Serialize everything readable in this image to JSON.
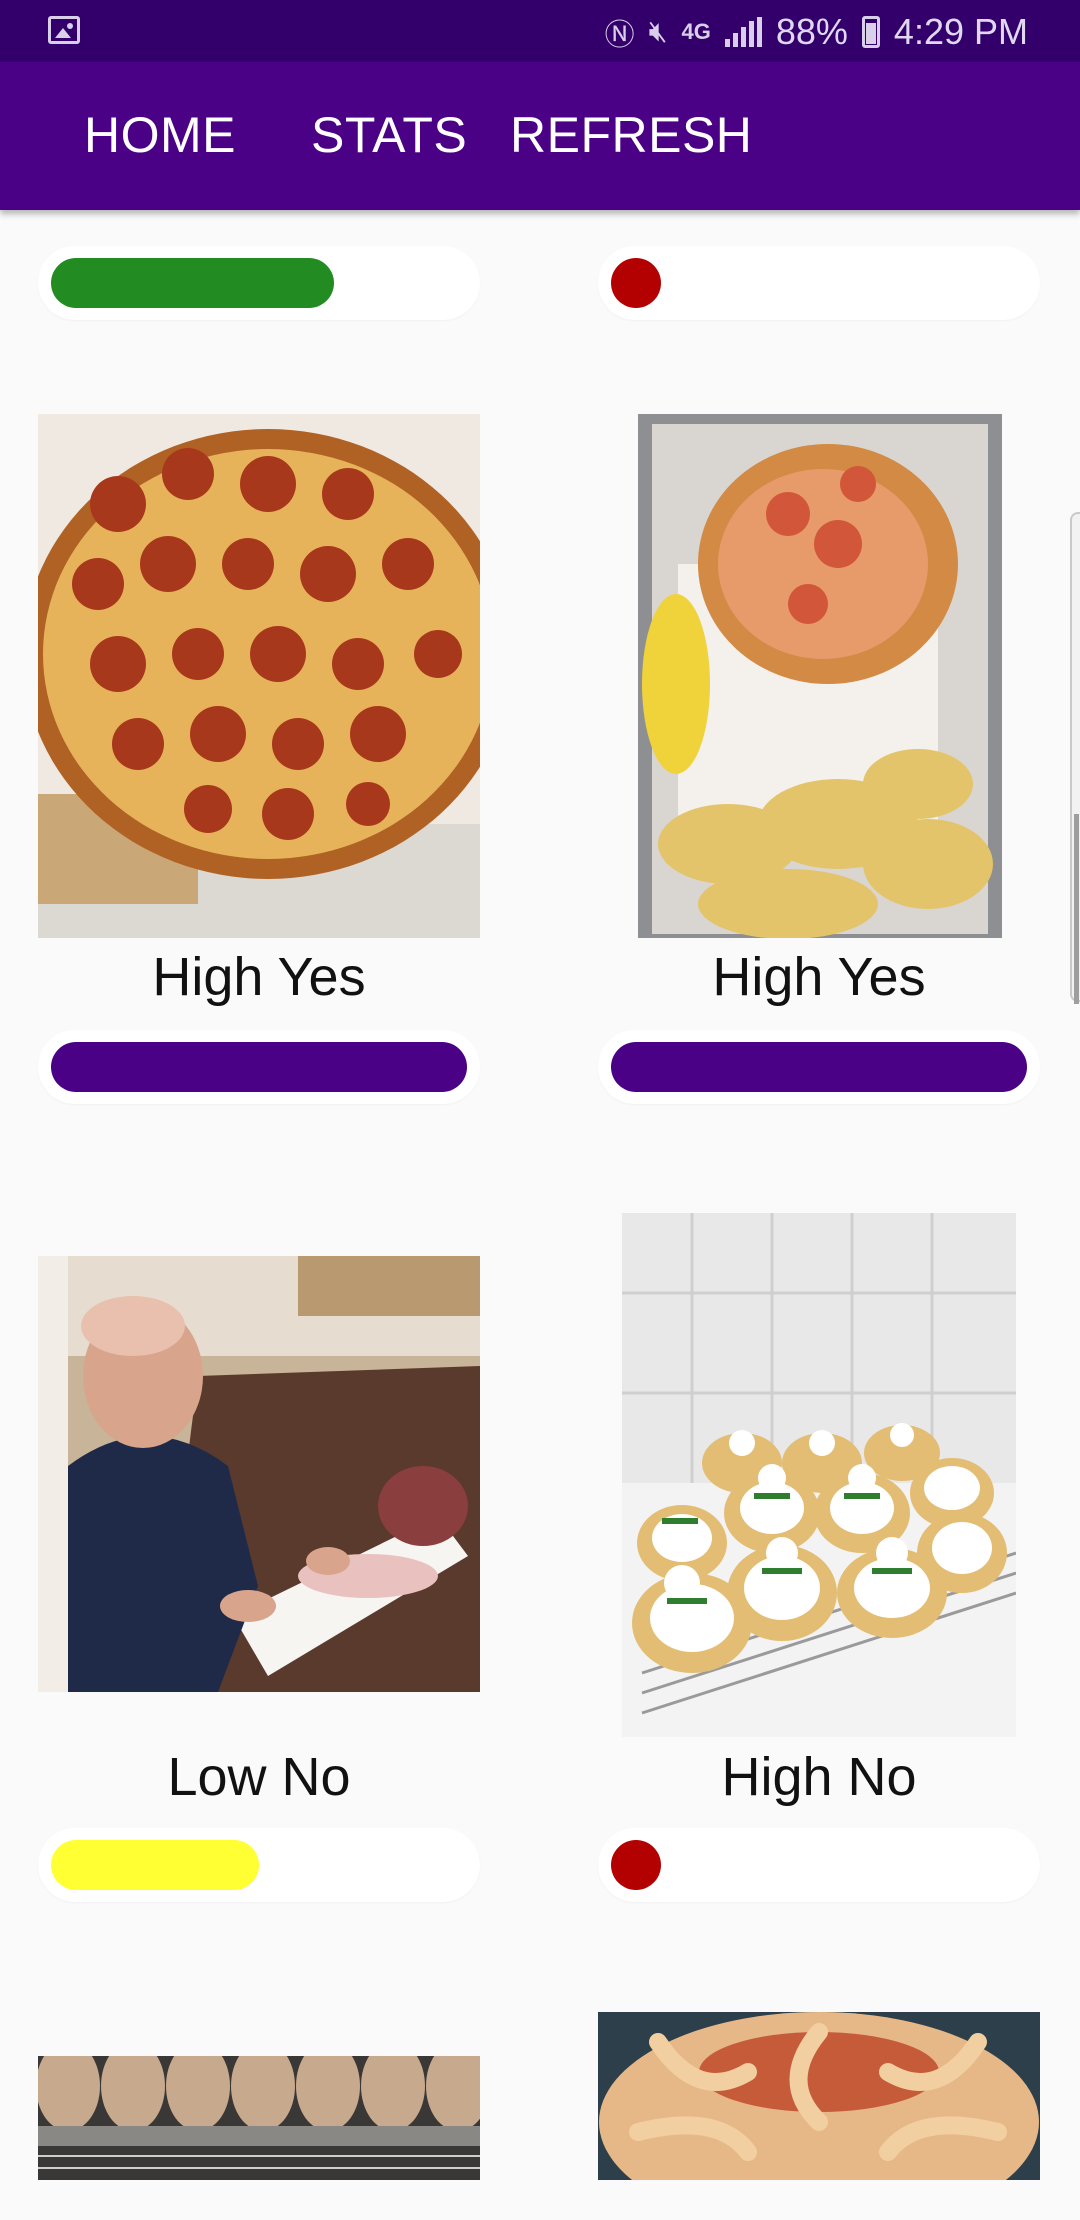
{
  "status_bar": {
    "battery": "88%",
    "time": "4:29 PM",
    "network": "4G",
    "icons": [
      "gallery-icon",
      "nfc-icon",
      "mute-icon",
      "lte-icon",
      "signal-icon",
      "battery-icon"
    ]
  },
  "nav": {
    "home": "HOME",
    "stats": "STATS",
    "refresh": "REFRESH"
  },
  "colors": {
    "status_bar": "#33006b",
    "app_bar": "#4a0185",
    "bar_high_yes": "#4a0185",
    "bar_green": "#228b22",
    "bar_red": "#b30000",
    "bar_yellow": "#ffff33"
  },
  "items": [
    {
      "label": "",
      "bar_color": "#228b22",
      "bar_fraction": 0.68,
      "image": "food-photo-partial"
    },
    {
      "label": "",
      "bar_color": "#b30000",
      "bar_fraction": 0.12,
      "image": "food-photo-partial"
    },
    {
      "label": "High Yes",
      "bar_color": "#4a0185",
      "bar_fraction": 1.0,
      "image": "pepperoni-pizza-photo"
    },
    {
      "label": "High Yes",
      "bar_color": "#4a0185",
      "bar_fraction": 1.0,
      "image": "lobster-roll-chips-photo"
    },
    {
      "label": "Low No",
      "bar_color": "#ffff33",
      "bar_fraction": 0.5,
      "image": "man-with-meat-photo"
    },
    {
      "label": "High No",
      "bar_color": "#b30000",
      "bar_fraction": 0.12,
      "image": "snowman-cookies-photo"
    },
    {
      "label": "",
      "bar_color": "",
      "bar_fraction": 0,
      "image": "pastries-photo-partial"
    },
    {
      "label": "",
      "bar_color": "",
      "bar_fraction": 0,
      "image": "octopus-pie-photo-partial"
    }
  ]
}
